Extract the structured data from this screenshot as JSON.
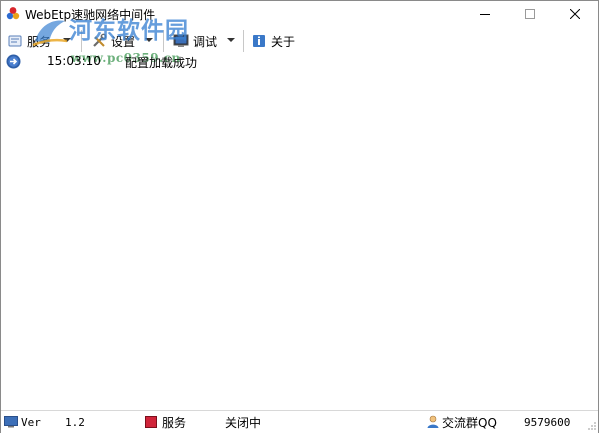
{
  "window": {
    "title": "WebEtp速驰网络中间件"
  },
  "watermark": {
    "text": "河东软件园",
    "url": "www.pc0359.cn"
  },
  "toolbar": {
    "items": [
      {
        "label": "服务",
        "icon": "service-icon",
        "has_dropdown": true
      },
      {
        "label": "设置",
        "icon": "settings-tools-icon",
        "has_dropdown": true
      },
      {
        "label": "调试",
        "icon": "debug-monitor-icon",
        "has_dropdown": true
      },
      {
        "label": "关于",
        "icon": "info-book-icon",
        "has_dropdown": false
      }
    ]
  },
  "log": {
    "entries": [
      {
        "time": "15:03:10",
        "message": "配置加载成功",
        "icon": "info-arrow-icon"
      }
    ]
  },
  "statusbar": {
    "ver_label": "Ver",
    "ver_value": "1.2",
    "service_label": "服务",
    "service_state": "关闭中",
    "qq_label": "交流群QQ",
    "qq_number": "9579600"
  },
  "colors": {
    "service_indicator": "#d0243a",
    "log_icon": "#2f5fa8",
    "watermark_text": "#3a82d2",
    "watermark_url": "#3c9650"
  }
}
